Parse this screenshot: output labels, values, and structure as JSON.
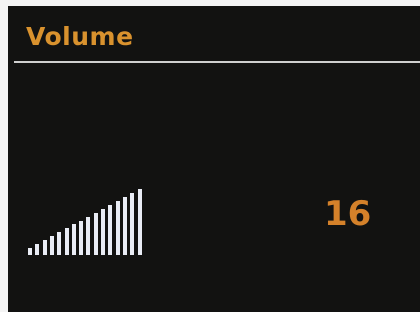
{
  "screen": {
    "title": "Volume",
    "volume_value": "16",
    "volume_level": 16,
    "volume_max": 16,
    "colors": {
      "background": "#121211",
      "title": "#d9922e",
      "value": "#d4812a",
      "bars": "#e9ecf5",
      "rule": "#cfcfcf"
    }
  }
}
